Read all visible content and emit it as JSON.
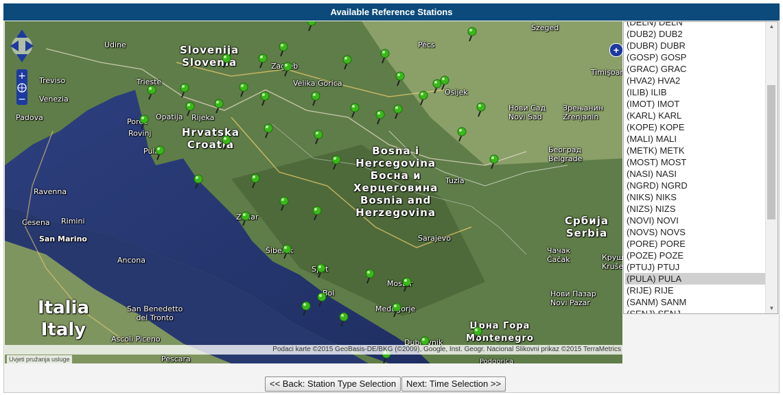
{
  "header": {
    "title": "Available Reference Stations"
  },
  "map": {
    "attribution": "Podaci karte ©2015 GeoBasis-DE/BKG (©2009), Google, Inst. Geogr. Nacional Slikovni prikaz ©2015 TerraMetrics",
    "terms": "Uvjeti pružanja usluge",
    "labels": {
      "udine": "Udine",
      "slovenija": "Slovenija",
      "slovenia": "Slovenia",
      "szeged": "Szeged",
      "pecs": "Pécs",
      "timisoara": "Timişoar",
      "trieste": "Trieste",
      "treviso": "Treviso",
      "venezia": "Venezia",
      "padova": "Padova",
      "zagreb": "Zagreb",
      "velika_gorica": "Velika Gorica",
      "osijek": "Osijek",
      "novi_sad_cyr": "Нови Сад",
      "novi_sad": "Novi Sad",
      "zrenjanin_cyr": "Зрењанин",
      "zrenjanin": "Zrenjanin",
      "opatija": "Opatija",
      "rijeka": "Rijeka",
      "porec": "Poreč",
      "rovinj": "Rovinj",
      "pula": "Pula",
      "hrvatska": "Hrvatska",
      "croatia": "Croatia",
      "ravenna": "Ravenna",
      "rimini": "Rimini",
      "cesena": "Cesena",
      "bosna_1": "Bosna i",
      "bosna_2": "Hercegovina",
      "bosna_3": "Босна и",
      "bosna_4": "Херцеговина",
      "bosna_5": "Bosnia and",
      "bosna_6": "Herzegovina",
      "beograd_cyr": "Београд",
      "beograd": "Belgrade",
      "tuzla": "Tuzla",
      "zadar": "Zadar",
      "san_marino": "San Marino",
      "srbija": "Србија",
      "serbia": "Serbia",
      "sarajevo": "Sarajevo",
      "sibenik": "Šibenik",
      "split": "Split",
      "ancona": "Ancona",
      "mostar": "Mostar",
      "cacak_cyr": "Чачак",
      "cacak": "Čačak",
      "krusevac": "Круш",
      "krusevac2": "Kruše",
      "novi_pazar_cyr": "Нови Пазар",
      "novi_pazar": "Novi Pazar",
      "bol": "Bol",
      "medjugorje": "Međugorje",
      "italia": "Italia",
      "italy": "Italy",
      "san_benedetto_1": "San Benedetto",
      "san_benedetto_2": "del Tronto",
      "crna_gora_cyr": "Црна Гора",
      "montenegro": "Montenegro",
      "ascoli": "Ascoli Piceno",
      "dubrovnik": "Dubrovnik",
      "pescara": "Pescara",
      "podgorica": "Podgorica"
    },
    "markers_color": "#3ab81a"
  },
  "stations": [
    {
      "label": "(DELN) DELN"
    },
    {
      "label": "(DUB2) DUB2"
    },
    {
      "label": "(DUBR) DUBR"
    },
    {
      "label": "(GOSP) GOSP"
    },
    {
      "label": "(GRAC) GRAC"
    },
    {
      "label": "(HVA2) HVA2"
    },
    {
      "label": "(ILIB) ILIB"
    },
    {
      "label": "(IMOT) IMOT"
    },
    {
      "label": "(KARL) KARL"
    },
    {
      "label": "(KOPE) KOPE"
    },
    {
      "label": "(MALI) MALI"
    },
    {
      "label": "(METK) METK"
    },
    {
      "label": "(MOST) MOST"
    },
    {
      "label": "(NASI) NASI"
    },
    {
      "label": "(NGRD) NGRD"
    },
    {
      "label": "(NIKS) NIKS"
    },
    {
      "label": "(NIZS) NIZS"
    },
    {
      "label": "(NOVI) NOVI"
    },
    {
      "label": "(NOVS) NOVS"
    },
    {
      "label": "(PORE) PORE"
    },
    {
      "label": "(POZE) POZE"
    },
    {
      "label": "(PTUJ) PTUJ"
    },
    {
      "label": "(PULA) PULA"
    },
    {
      "label": "(RIJE) RIJE"
    },
    {
      "label": "(SANM) SANM"
    },
    {
      "label": "(SENJ) SENJ"
    }
  ],
  "selected_station": "(PULA) PULA",
  "buttons": {
    "back": "<< Back: Station Type Selection",
    "next": "Next: Time Selection >>"
  }
}
